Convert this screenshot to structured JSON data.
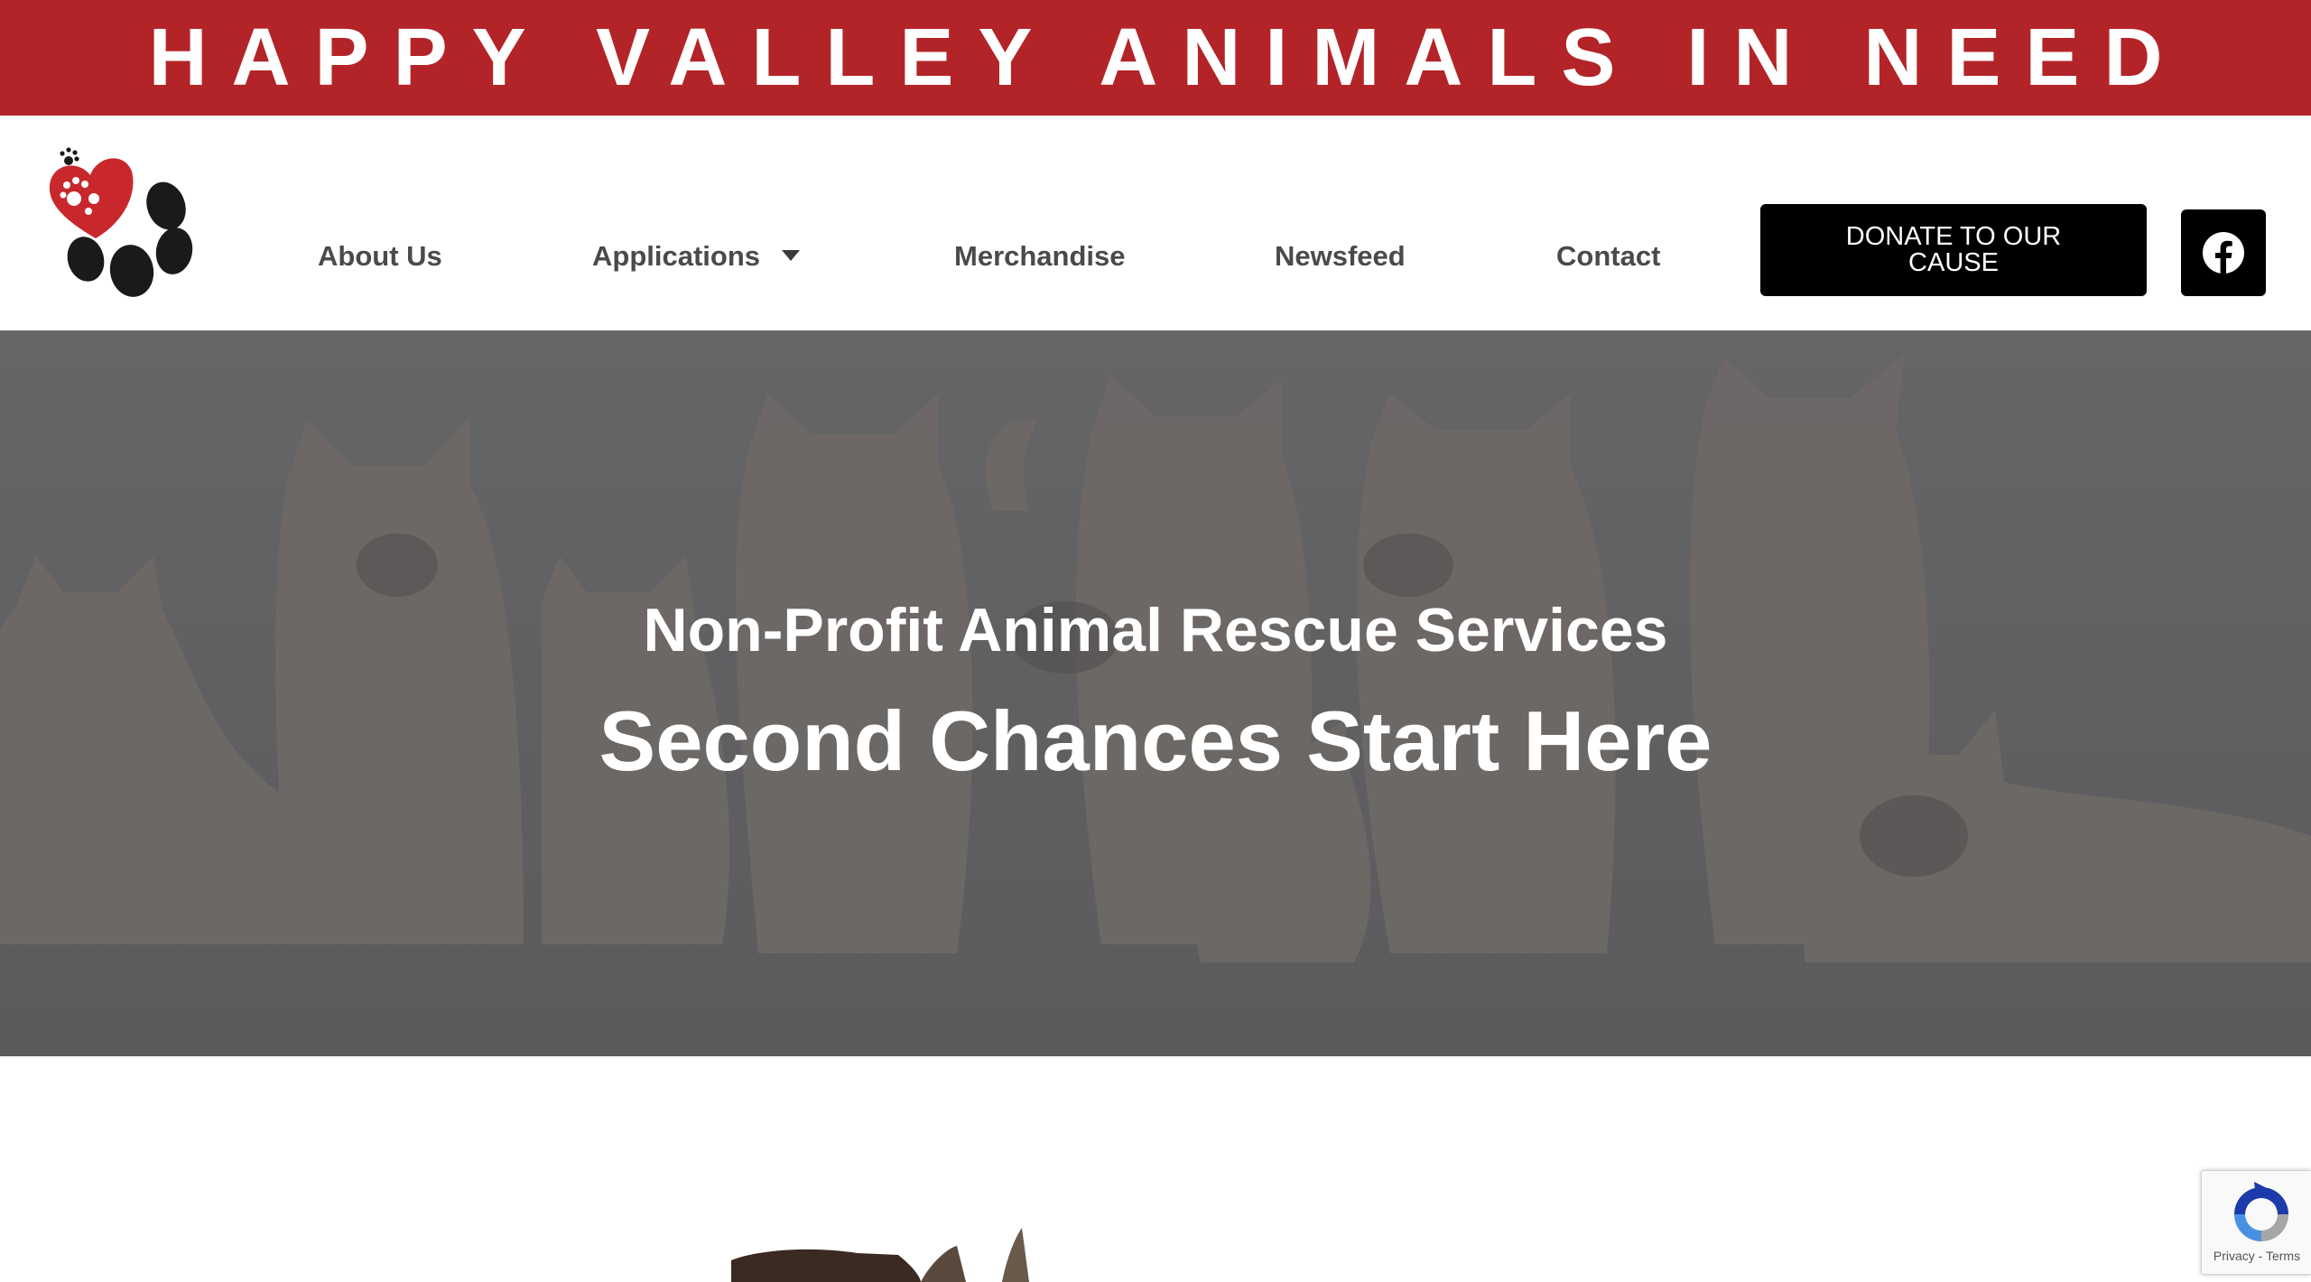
{
  "colors": {
    "banner_red": "#b32428",
    "logo_red": "#c8282c",
    "paw_black": "#1a1a1a",
    "button_black": "#000000",
    "nav_text": "#4a4a4a",
    "hero_overlay": "#5f5f61"
  },
  "banner": {
    "title": "HAPPY VALLEY ANIMALS IN NEED"
  },
  "header": {
    "logo_icon": "heart-paw-logo",
    "nav": {
      "about": "About Us",
      "applications": "Applications",
      "merchandise": "Merchandise",
      "newsfeed": "Newsfeed",
      "contact": "Contact"
    },
    "donate_label": "DONATE TO OUR CAUSE",
    "social_icon": "facebook-icon"
  },
  "hero": {
    "subtitle": "Non-Profit Animal Rescue Services",
    "title": "Second Chances Start Here",
    "background_icon": "kittens-photo"
  },
  "recaptcha": {
    "privacy": "Privacy",
    "separator": " - ",
    "terms": "Terms",
    "icon": "recaptcha-icon"
  }
}
